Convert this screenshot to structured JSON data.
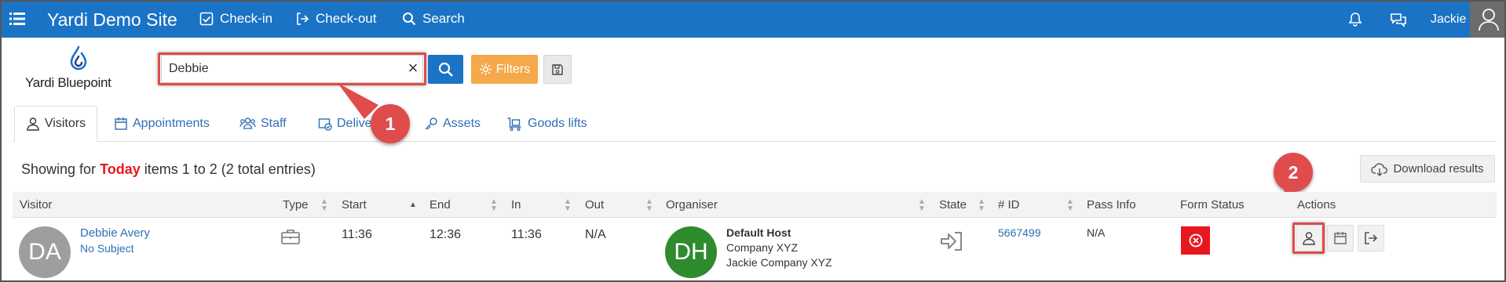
{
  "topbar": {
    "site_title": "Yardi Demo Site",
    "checkin_label": "Check-in",
    "checkout_label": "Check-out",
    "search_label": "Search",
    "user_name": "Jackie",
    "bg_color": "#1a73c5"
  },
  "logo": {
    "text": "Yardi Bluepoint"
  },
  "search": {
    "value": "Debbie",
    "clear_glyph": "×"
  },
  "toolbar": {
    "filters_label": "Filters"
  },
  "tabs": [
    {
      "label": "Visitors",
      "icon": "visitor-icon",
      "active": true
    },
    {
      "label": "Appointments",
      "icon": "calendar-icon"
    },
    {
      "label": "Staff",
      "icon": "staff-icon"
    },
    {
      "label": "Deliveries",
      "icon": "delivery-icon"
    },
    {
      "label": "Assets",
      "icon": "key-icon"
    },
    {
      "label": "Goods lifts",
      "icon": "cart-icon"
    }
  ],
  "callouts": {
    "one": "1",
    "two": "2",
    "color": "#e04b4b"
  },
  "summary": {
    "prefix": "Showing for ",
    "period": "Today",
    "suffix": " items 1 to 2 (2 total entries)"
  },
  "download_label": "Download results",
  "table": {
    "columns": [
      "Visitor",
      "Type",
      "Start",
      "End",
      "In",
      "Out",
      "Organiser",
      "State",
      "# ID",
      "Pass Info",
      "Form Status",
      "Actions"
    ],
    "rows": [
      {
        "initials": "DA",
        "visitor_name": "Debbie Avery",
        "subject": "No Subject",
        "type_icon": "briefcase-icon",
        "start": "11:36",
        "end": "12:36",
        "in": "11:36",
        "out": "N/A",
        "organiser_initials": "DH",
        "organiser_name": "Default Host",
        "organiser_company": "Company XYZ",
        "organiser_contact": "Jackie Company XYZ",
        "state_icon": "sign-in-icon",
        "id": "5667499",
        "pass_info": "N/A",
        "form_status_icon": "error-icon",
        "form_status_color": "#e8171f"
      }
    ]
  }
}
